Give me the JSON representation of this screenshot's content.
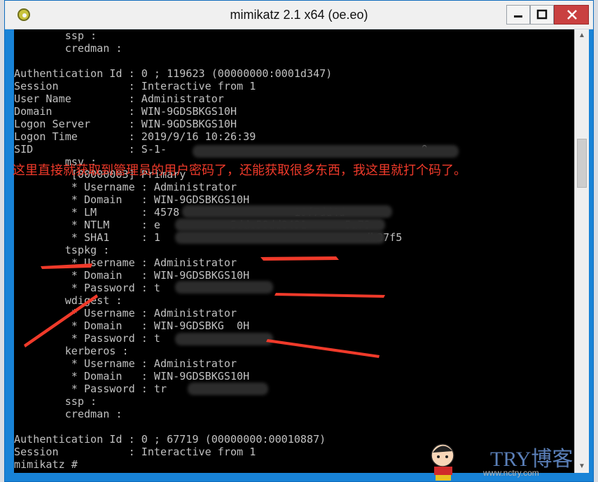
{
  "window": {
    "title": "mimikatz 2.1 x64 (oe.eo)"
  },
  "console_lines": [
    "        ssp :",
    "        credman :",
    "",
    "Authentication Id : 0 ; 119623 (00000000:0001d347)",
    "Session           : Interactive from 1",
    "User Name         : Administrator",
    "Domain            : WIN-9GDSBKGS10H",
    "Logon Server      : WIN-9GDSBKGS10H",
    "Logon Time        : 2019/9/16 10:26:39",
    "SID               : S-1-                                        0",
    "        msv :",
    "         [00000003] Primary",
    "         * Username : Administrator",
    "         * Domain   : WIN-9GDSBKGS10H",
    "         * LM       : 4578                  10f7dd4d",
    "         * NTLM     : e           5dde58dd8431      5a79",
    "         * SHA1     : 1                               adb37f5",
    "        tspkg :",
    "         * Username : Administrator",
    "         * Domain   : WIN-9GDSBKGS10H",
    "         * Password : t",
    "        wdigest :",
    "         * Username : Administrator",
    "         * Domain   : WIN-9GDSBKG  0H",
    "         * Password : t",
    "        kerberos :",
    "         * Username : Administrator",
    "         * Domain   : WIN-9GDSBKGS10H",
    "         * Password : tr",
    "        ssp :",
    "        credman :",
    "",
    "Authentication Id : 0 ; 67719 (00000000:00010887)",
    "Session           : Interactive from 1",
    "mimikatz #"
  ],
  "annotation": "这里直接就获取到管理员的用户密码了，还能获取很多东西，我这里就打个码了。",
  "watermark": {
    "text": "TRY博客",
    "sub": "www.nctry.com"
  },
  "icons": [
    "mimikatz-app-icon",
    "minimize-icon",
    "maximize-icon",
    "close-icon"
  ],
  "colors": {
    "annotation": "#f03a2a",
    "console_bg": "#000000",
    "console_text": "#c0c0c0",
    "close": "#c94040"
  }
}
